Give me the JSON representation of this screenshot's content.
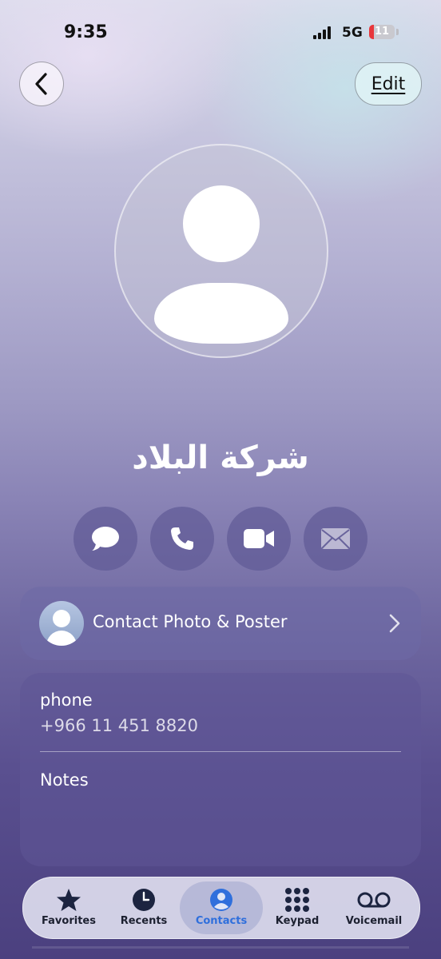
{
  "status_bar": {
    "time": "9:35",
    "network": "5G",
    "battery": "11"
  },
  "header": {
    "edit_label": "Edit"
  },
  "contact": {
    "name": "شركة البلاد"
  },
  "actions": [
    {
      "name": "message",
      "icon": "message-bubble-icon"
    },
    {
      "name": "call",
      "icon": "phone-icon"
    },
    {
      "name": "video",
      "icon": "video-camera-icon"
    },
    {
      "name": "mail",
      "icon": "envelope-icon"
    }
  ],
  "poster_card": {
    "label": "Contact Photo & Poster"
  },
  "info_card": {
    "phone_label": "phone",
    "phone_value": "+966 11 451 8820",
    "notes_label": "Notes"
  },
  "tabs": [
    {
      "label": "Favorites",
      "icon": "star-icon"
    },
    {
      "label": "Recents",
      "icon": "clock-icon"
    },
    {
      "label": "Contacts",
      "icon": "person-circle-icon",
      "active": true
    },
    {
      "label": "Keypad",
      "icon": "keypad-icon"
    },
    {
      "label": "Voicemail",
      "icon": "voicemail-icon"
    }
  ],
  "colors": {
    "active_tab": "#2f6fdc"
  }
}
